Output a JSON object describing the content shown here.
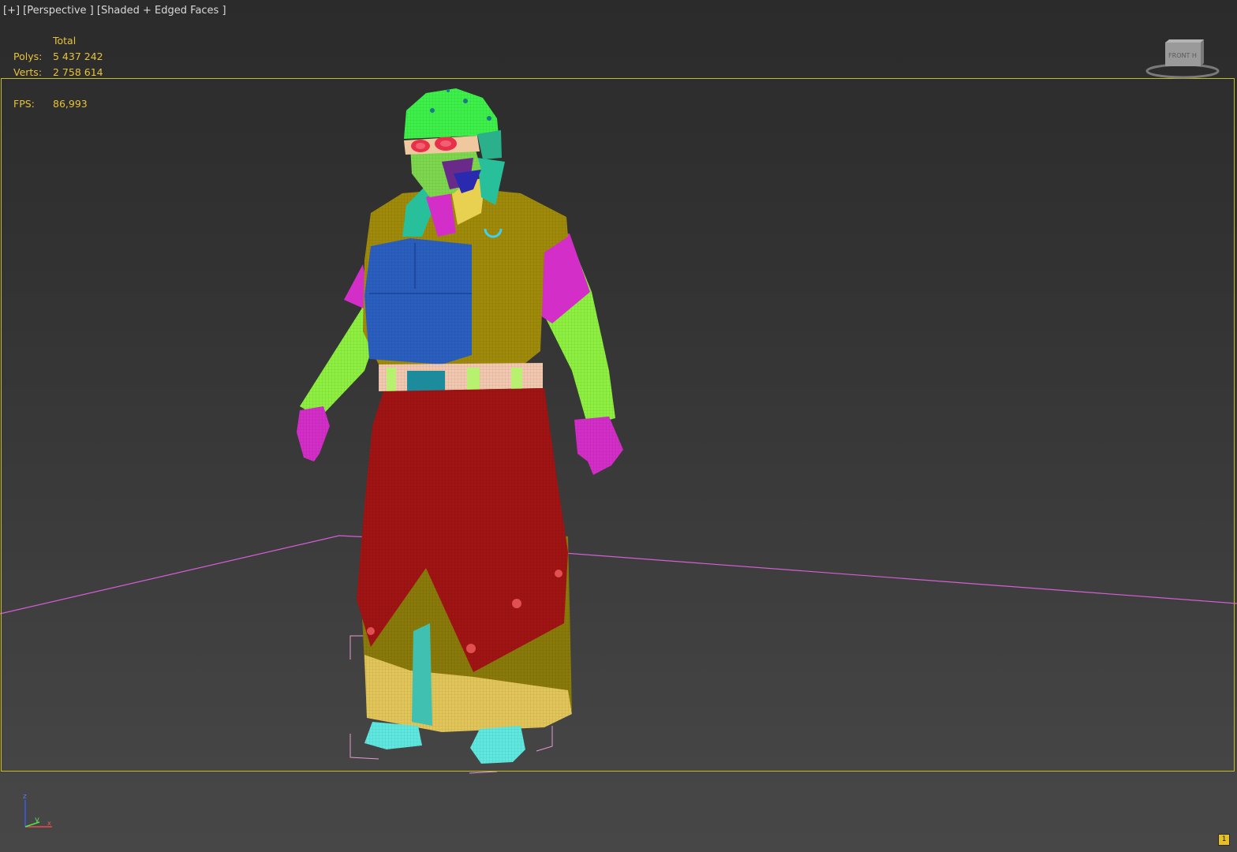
{
  "viewport": {
    "label": "[+] [Perspective ] [Shaded + Edged Faces ]",
    "stats": {
      "header": "Total",
      "polys_label": "Polys:",
      "polys_value": "5 437 242",
      "verts_label": "Verts:",
      "verts_value": "2 758 614",
      "fps_label": "FPS:",
      "fps_value": "86,993"
    },
    "viewcube": {
      "face_label": "FRONT  H"
    },
    "axis": {
      "x": "x",
      "y": "y",
      "z": "z"
    },
    "badge": "1"
  },
  "colors": {
    "frame_border": "#c8bb1e",
    "stats_text": "#e8c33a",
    "ground_grid": "#d45fd4"
  },
  "icons": {
    "viewcube": "viewcube-icon",
    "axis_tripod": "axis-tripod-icon"
  }
}
